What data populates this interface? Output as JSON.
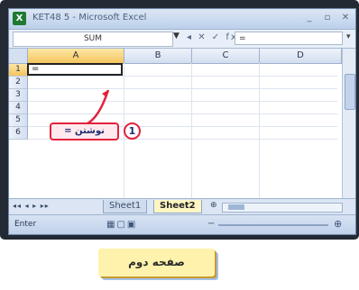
{
  "window": {
    "title": "KET48 5 - Microsoft Excel",
    "app_icon": "X",
    "controls": [
      "_",
      "▫",
      "✕"
    ]
  },
  "formula_bar": {
    "name_box": "SUM",
    "name_box_arrow": "▼",
    "icons": "◂ ✕ ✓ fx",
    "value": "=",
    "expand": "▾"
  },
  "grid": {
    "columns": [
      "A",
      "B",
      "C",
      "D"
    ],
    "rows": [
      "1",
      "2",
      "3",
      "4",
      "5",
      "6"
    ],
    "active_cell": "A1",
    "active_value": "="
  },
  "sheet_tabs": {
    "nav": "◂◂ ◂ ▸ ▸▸",
    "tabs": [
      "Sheet1",
      "Sheet2"
    ],
    "active": "Sheet2",
    "add": "⊕"
  },
  "status_bar": {
    "mode": "Enter",
    "view_icons": "▦▢▣",
    "zoom_minus": "−",
    "zoom_plus": "⊕"
  },
  "annotation": {
    "step_number": "1",
    "callout_text": "نوشتن ="
  },
  "caption": {
    "text": "صفحه دوم"
  },
  "colors": {
    "accent_red": "#e2223c",
    "caption_bg": "#fff2ad",
    "active_header": "#f4c55e"
  }
}
